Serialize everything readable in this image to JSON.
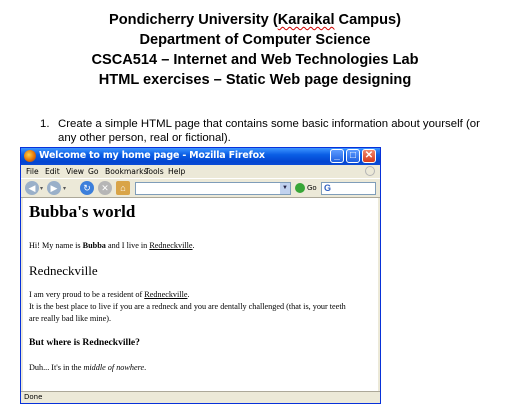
{
  "document": {
    "title_line1_prefix": "Pondicherry University (",
    "title_line1_word": "Karaikal",
    "title_line1_suffix": " Campus)",
    "title_line2": "Department of Computer Science",
    "title_line3": "CSCA514 – Internet and Web Technologies Lab",
    "title_line4": "HTML exercises – Static Web page designing",
    "exercise_number": "1.",
    "exercise_line1": "Create a simple HTML page that contains some basic information about yourself (or",
    "exercise_line2": "any other person, real or fictional)."
  },
  "browser": {
    "window_title": "Welcome to my home page - Mozilla Firefox",
    "menu": [
      "File",
      "Edit",
      "View",
      "Go",
      "Bookmarks",
      "Tools",
      "Help"
    ],
    "go_label": "Go",
    "search_glyph": "G",
    "status_text": "Done",
    "colors": {
      "titlebar": "#0a5ee5",
      "chrome": "#ece9d8"
    }
  },
  "page": {
    "heading": "Bubba's world",
    "intro_a": "Hi! My name is ",
    "intro_name": "Bubba",
    "intro_b": " and I live in ",
    "intro_link": "Redneckville",
    "intro_c": ".",
    "subheading": "Redneckville",
    "para_a": "I am very proud to be a resident of ",
    "para_link": "Redneckville",
    "para_b": ".",
    "para_line2": "It is the best place to live if you are a redneck and you are dentally challenged (that is, your teeth",
    "para_line3": "are really bad like mine).",
    "question": "But where is Redneckville?",
    "answer_a": "Duh... It's in the ",
    "answer_em": "middle of nowhere",
    "answer_b": "."
  }
}
